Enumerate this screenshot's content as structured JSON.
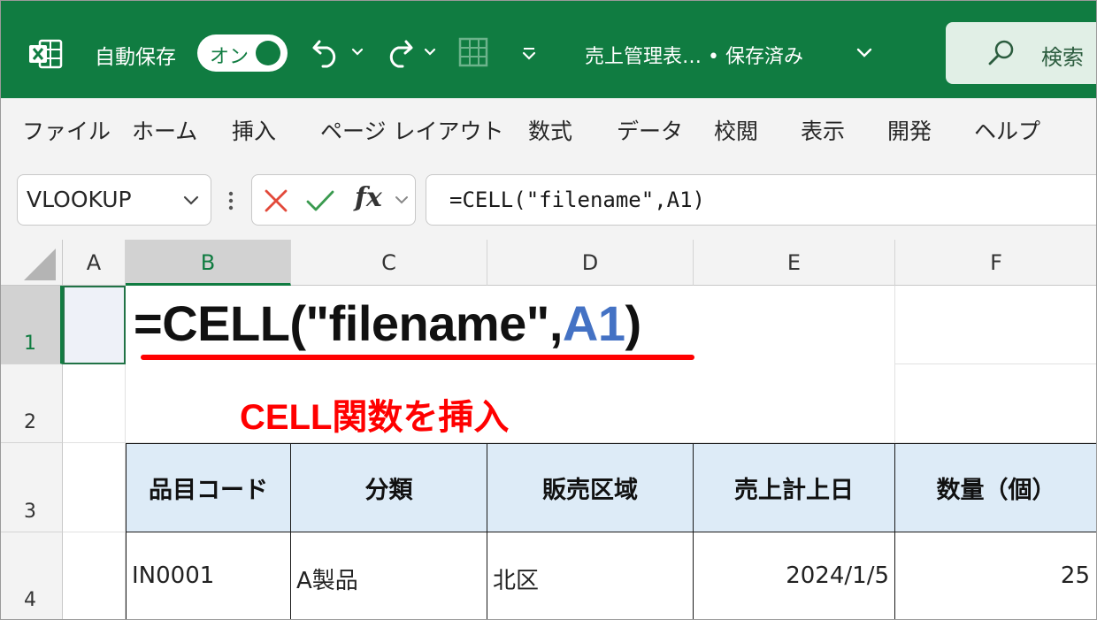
{
  "title_bar": {
    "autosave_label": "自動保存",
    "autosave_toggle": "オン",
    "document_title": "売上管理表… • 保存済み",
    "search_label": "検索",
    "accent_color": "#107c41"
  },
  "ribbon": {
    "tabs": [
      "ファイル",
      "ホーム",
      "挿入",
      "ページ レイアウト",
      "数式",
      "データ",
      "校閲",
      "表示",
      "開発",
      "ヘルプ"
    ]
  },
  "formula_bar": {
    "name_box": "VLOOKUP",
    "formula": "=CELL(\"filename\",A1)",
    "fx_label": "fx"
  },
  "sheet": {
    "columns": [
      "A",
      "B",
      "C",
      "D",
      "E",
      "F"
    ],
    "selected_column": "B",
    "rows": [
      "1",
      "2",
      "3",
      "4"
    ],
    "selected_row": "1",
    "editing_formula_prefix": "=CELL(\"filename\",",
    "editing_formula_ref": "A1",
    "editing_formula_suffix": ")",
    "annotation": "CELL関数を挿入",
    "annotation_color": "#ff0000",
    "table": {
      "headers": [
        "品目コード",
        "分類",
        "販売区域",
        "売上計上日",
        "数量（個）"
      ],
      "row": [
        "IN0001",
        "A製品",
        "北区",
        "2024/1/5",
        "25"
      ],
      "header_fill": "#ddebf7"
    }
  }
}
